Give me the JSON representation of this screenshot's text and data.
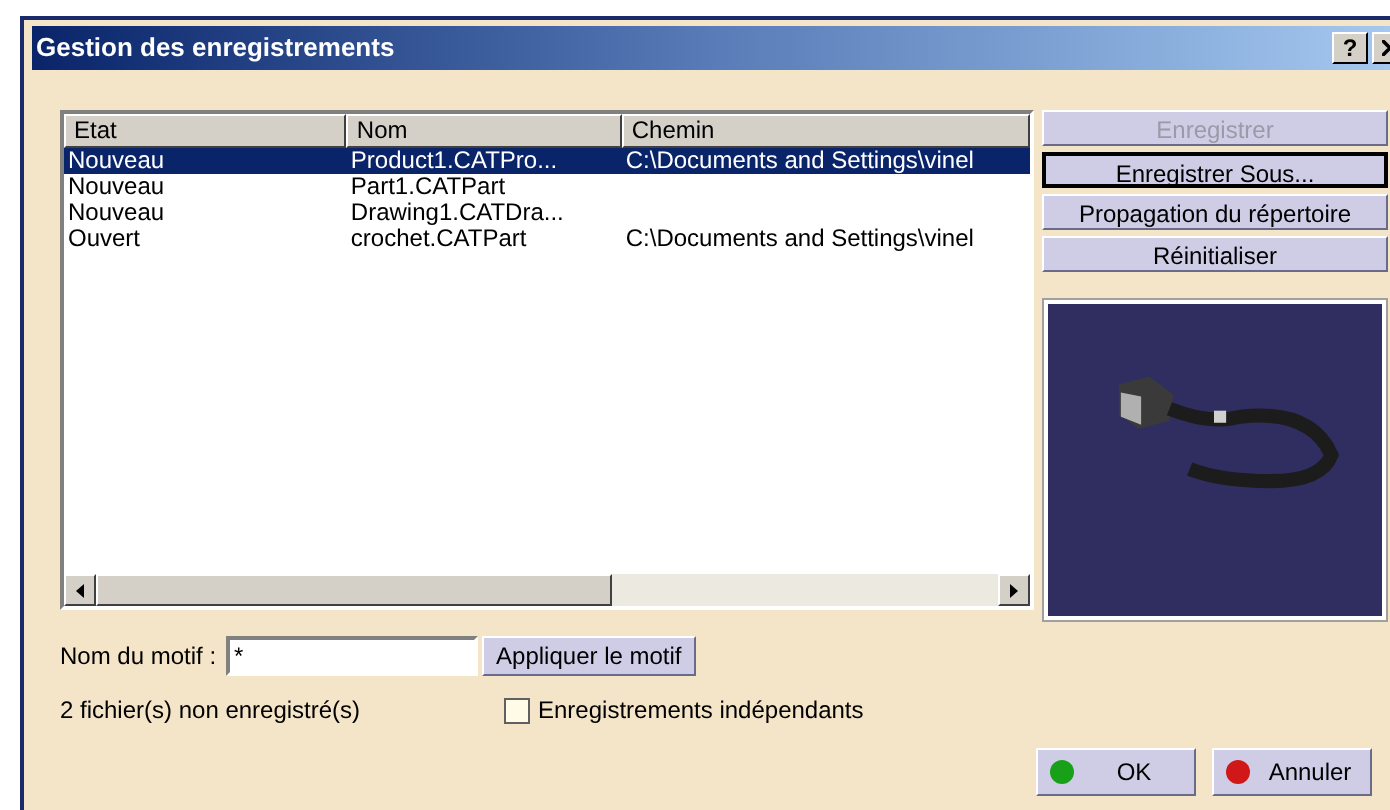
{
  "window": {
    "title": "Gestion des enregistrements",
    "help": "?"
  },
  "table": {
    "columns": [
      "Etat",
      "Nom",
      "Chemin"
    ],
    "rows": [
      {
        "cells": [
          "Nouveau",
          "Product1.CATPro...",
          "C:\\Documents and Settings\\vinel"
        ],
        "selected": true
      },
      {
        "cells": [
          "Nouveau",
          "Part1.CATPart",
          ""
        ],
        "selected": false
      },
      {
        "cells": [
          "Nouveau",
          "Drawing1.CATDra...",
          ""
        ],
        "selected": false
      },
      {
        "cells": [
          "Ouvert",
          "crochet.CATPart",
          "C:\\Documents and Settings\\vinel"
        ],
        "selected": false
      }
    ]
  },
  "side_buttons": [
    {
      "label": "Enregistrer",
      "disabled": true,
      "focused": false
    },
    {
      "label": "Enregistrer Sous...",
      "disabled": false,
      "focused": true
    },
    {
      "label": "Propagation du répertoire",
      "disabled": false,
      "focused": false
    },
    {
      "label": "Réinitialiser",
      "disabled": false,
      "focused": false
    }
  ],
  "pattern": {
    "label": "Nom du motif :",
    "value": "*",
    "apply": "Appliquer le motif"
  },
  "status": "2 fichier(s) non enregistré(s)",
  "independent": {
    "label": "Enregistrements indépendants",
    "checked": false
  },
  "footer_buttons": [
    {
      "label": "OK",
      "color": "#18a018"
    },
    {
      "label": "Annuler",
      "color": "#d01818"
    }
  ]
}
